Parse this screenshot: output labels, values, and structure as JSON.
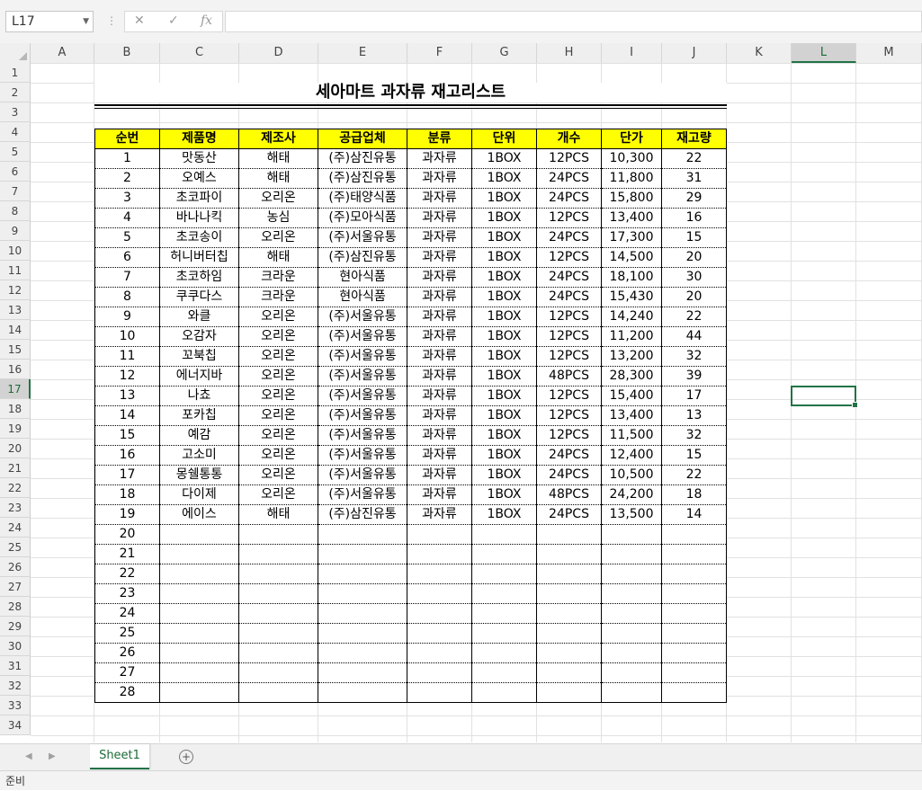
{
  "formula_bar": {
    "name_box": "L17",
    "cancel_icon": "✕",
    "enter_icon": "✓",
    "fx_label": "fx",
    "formula": ""
  },
  "columns": [
    "A",
    "B",
    "C",
    "D",
    "E",
    "F",
    "G",
    "H",
    "I",
    "J",
    "K",
    "L",
    "M"
  ],
  "rows": [
    "1",
    "2",
    "3",
    "4",
    "5",
    "6",
    "7",
    "8",
    "9",
    "10",
    "11",
    "12",
    "13",
    "14",
    "15",
    "16",
    "17",
    "18",
    "19",
    "20",
    "21",
    "22",
    "23",
    "24",
    "25",
    "26",
    "27",
    "28",
    "29",
    "30",
    "31",
    "32",
    "33",
    "34"
  ],
  "selected_cell": "L17",
  "title": "세아마트 과자류 재고리스트",
  "table": {
    "headers": [
      "순번",
      "제품명",
      "제조사",
      "공급업체",
      "분류",
      "단위",
      "개수",
      "단가",
      "재고량"
    ],
    "rows": [
      [
        "1",
        "맛동산",
        "해태",
        "(주)삼진유통",
        "과자류",
        "1BOX",
        "12PCS",
        "10,300",
        "22"
      ],
      [
        "2",
        "오예스",
        "해태",
        "(주)삼진유통",
        "과자류",
        "1BOX",
        "24PCS",
        "11,800",
        "31"
      ],
      [
        "3",
        "초코파이",
        "오리온",
        "(주)태양식품",
        "과자류",
        "1BOX",
        "24PCS",
        "15,800",
        "29"
      ],
      [
        "4",
        "바나나킥",
        "농심",
        "(주)모아식품",
        "과자류",
        "1BOX",
        "12PCS",
        "13,400",
        "16"
      ],
      [
        "5",
        "초코송이",
        "오리온",
        "(주)서울유통",
        "과자류",
        "1BOX",
        "24PCS",
        "17,300",
        "15"
      ],
      [
        "6",
        "허니버터칩",
        "해태",
        "(주)삼진유통",
        "과자류",
        "1BOX",
        "12PCS",
        "14,500",
        "20"
      ],
      [
        "7",
        "초코하임",
        "크라운",
        "현아식품",
        "과자류",
        "1BOX",
        "24PCS",
        "18,100",
        "30"
      ],
      [
        "8",
        "쿠쿠다스",
        "크라운",
        "현아식품",
        "과자류",
        "1BOX",
        "24PCS",
        "15,430",
        "20"
      ],
      [
        "9",
        "와클",
        "오리온",
        "(주)서울유통",
        "과자류",
        "1BOX",
        "12PCS",
        "14,240",
        "22"
      ],
      [
        "10",
        "오감자",
        "오리온",
        "(주)서울유통",
        "과자류",
        "1BOX",
        "12PCS",
        "11,200",
        "44"
      ],
      [
        "11",
        "꼬북칩",
        "오리온",
        "(주)서울유통",
        "과자류",
        "1BOX",
        "12PCS",
        "13,200",
        "32"
      ],
      [
        "12",
        "에너지바",
        "오리온",
        "(주)서울유통",
        "과자류",
        "1BOX",
        "48PCS",
        "28,300",
        "39"
      ],
      [
        "13",
        "나쵸",
        "오리온",
        "(주)서울유통",
        "과자류",
        "1BOX",
        "12PCS",
        "15,400",
        "17"
      ],
      [
        "14",
        "포카칩",
        "오리온",
        "(주)서울유통",
        "과자류",
        "1BOX",
        "12PCS",
        "13,400",
        "13"
      ],
      [
        "15",
        "예감",
        "오리온",
        "(주)서울유통",
        "과자류",
        "1BOX",
        "12PCS",
        "11,500",
        "32"
      ],
      [
        "16",
        "고소미",
        "오리온",
        "(주)서울유통",
        "과자류",
        "1BOX",
        "24PCS",
        "12,400",
        "15"
      ],
      [
        "17",
        "몽쉘통통",
        "오리온",
        "(주)서울유통",
        "과자류",
        "1BOX",
        "24PCS",
        "10,500",
        "22"
      ],
      [
        "18",
        "다이제",
        "오리온",
        "(주)서울유통",
        "과자류",
        "1BOX",
        "48PCS",
        "24,200",
        "18"
      ],
      [
        "19",
        "에이스",
        "해태",
        "(주)삼진유통",
        "과자류",
        "1BOX",
        "24PCS",
        "13,500",
        "14"
      ],
      [
        "20",
        "",
        "",
        "",
        "",
        "",
        "",
        "",
        ""
      ],
      [
        "21",
        "",
        "",
        "",
        "",
        "",
        "",
        "",
        ""
      ],
      [
        "22",
        "",
        "",
        "",
        "",
        "",
        "",
        "",
        ""
      ],
      [
        "23",
        "",
        "",
        "",
        "",
        "",
        "",
        "",
        ""
      ],
      [
        "24",
        "",
        "",
        "",
        "",
        "",
        "",
        "",
        ""
      ],
      [
        "25",
        "",
        "",
        "",
        "",
        "",
        "",
        "",
        ""
      ],
      [
        "26",
        "",
        "",
        "",
        "",
        "",
        "",
        "",
        ""
      ],
      [
        "27",
        "",
        "",
        "",
        "",
        "",
        "",
        "",
        ""
      ],
      [
        "28",
        "",
        "",
        "",
        "",
        "",
        "",
        "",
        ""
      ]
    ]
  },
  "sheet_tabs": [
    "Sheet1"
  ],
  "status": "준비",
  "colors": {
    "header_fill": "#ffff00",
    "accent": "#217346"
  }
}
